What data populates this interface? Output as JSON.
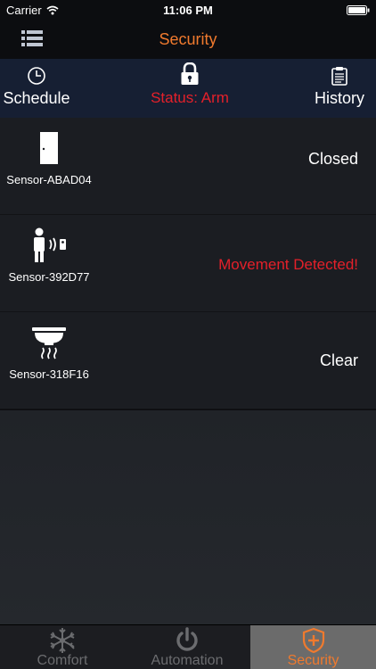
{
  "status_bar": {
    "carrier": "Carrier",
    "time": "11:06 PM"
  },
  "header": {
    "title": "Security",
    "menu_icon": "list-menu-icon"
  },
  "subnav": {
    "schedule": {
      "label": "Schedule",
      "icon": "clock-icon"
    },
    "status": {
      "label": "Status: Arm",
      "icon": "padlock-icon"
    },
    "history": {
      "label": "History",
      "icon": "clipboard-icon"
    }
  },
  "sensors": [
    {
      "name": "Sensor-ABAD04",
      "state": "Closed",
      "icon": "door-sensor-icon"
    },
    {
      "name": "Sensor-392D77",
      "state": "Movement Detected!",
      "icon": "motion-sensor-icon"
    },
    {
      "name": "Sensor-318F16",
      "state": "Clear",
      "icon": "smoke-detector-icon"
    }
  ],
  "tabs": [
    {
      "label": "Comfort",
      "icon": "snowflake-sun-icon"
    },
    {
      "label": "Automation",
      "icon": "power-icon"
    },
    {
      "label": "Security",
      "icon": "shield-plus-icon"
    }
  ],
  "colors": {
    "accent": "#f07a2e",
    "alert": "#e4202a",
    "subnav_bg": "#161f33"
  }
}
